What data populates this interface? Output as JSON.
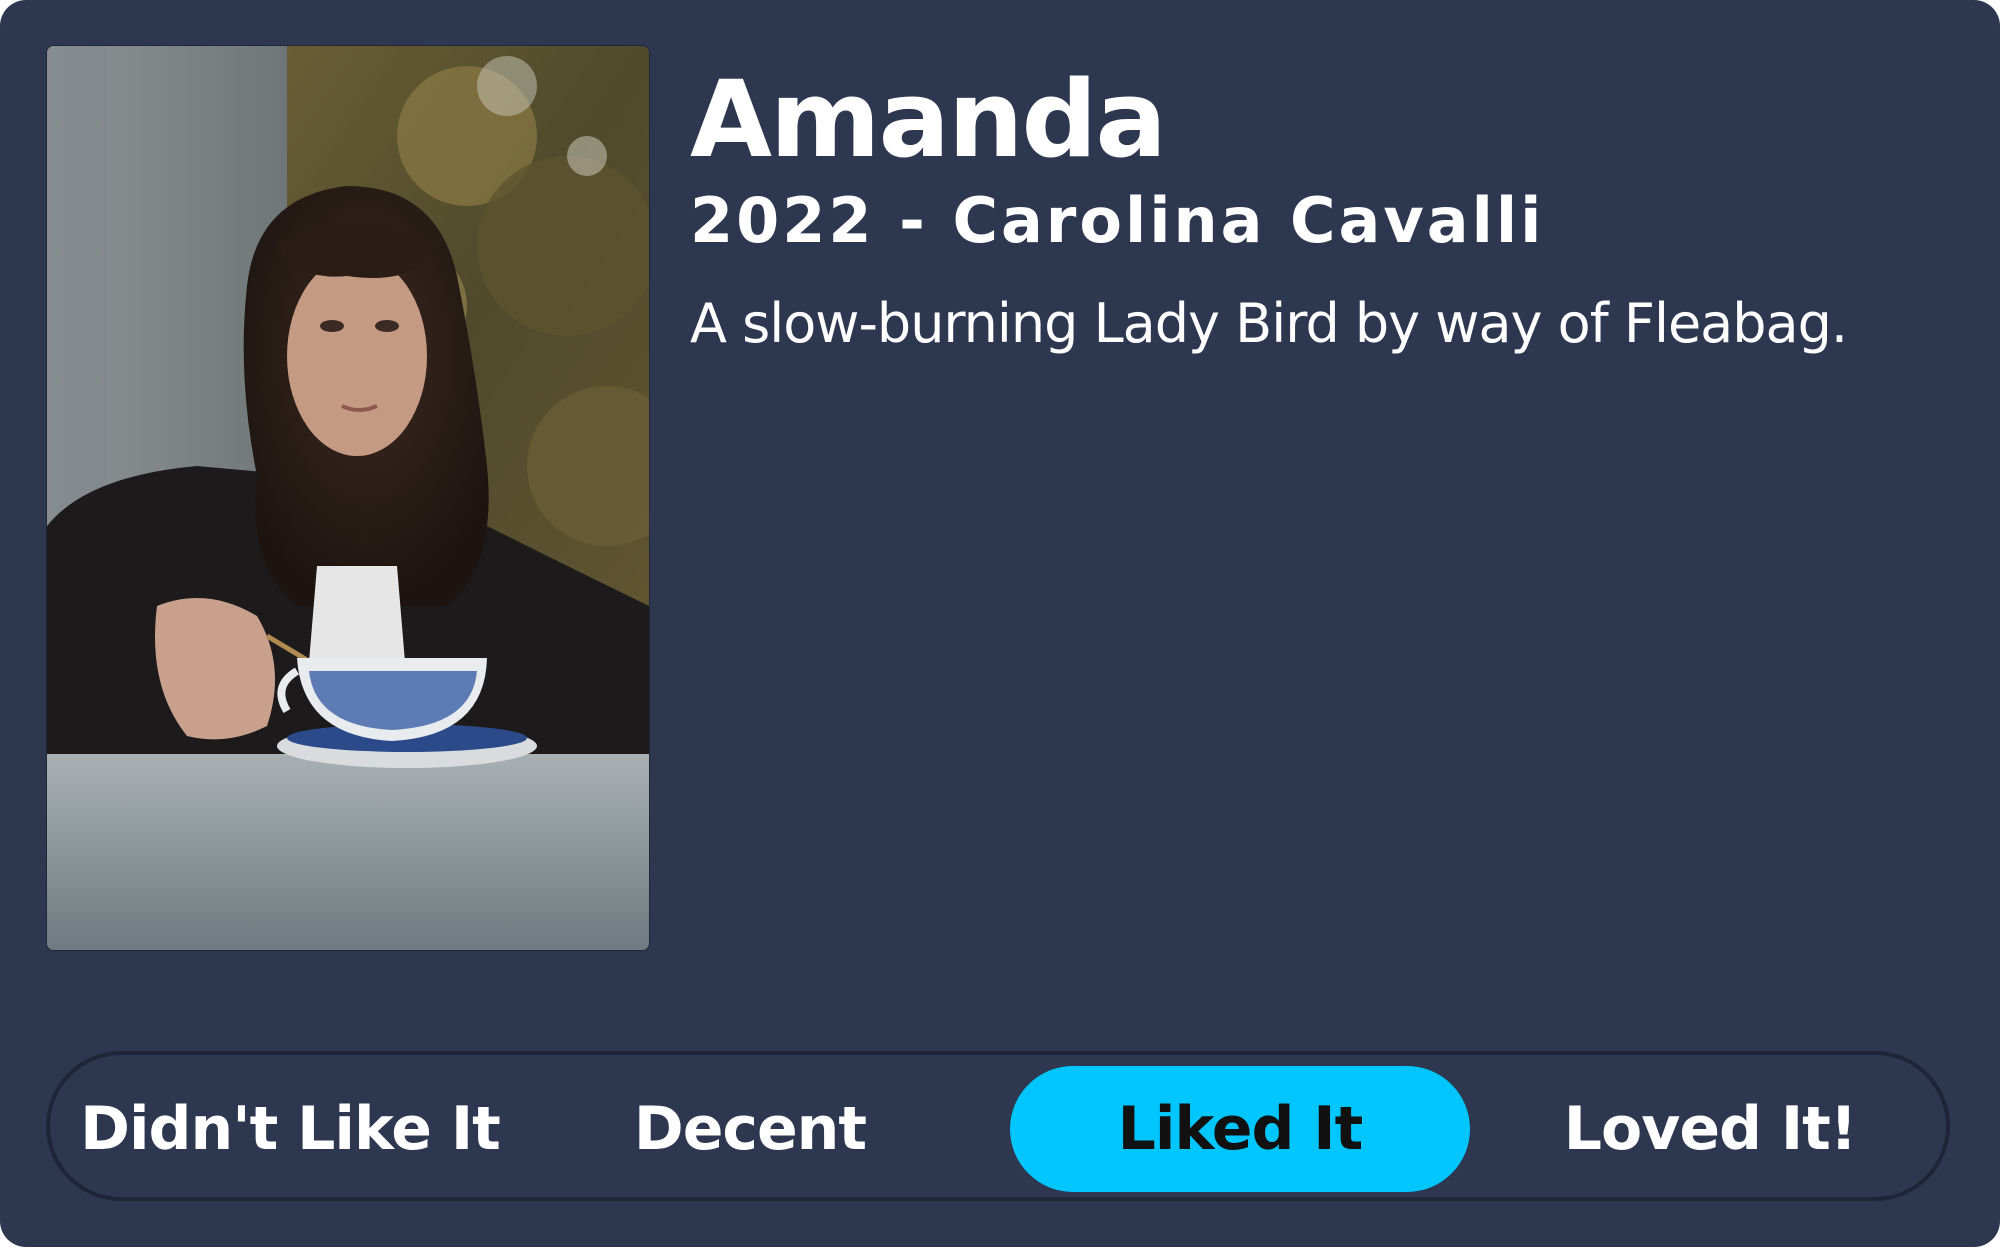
{
  "movie": {
    "title": "Amanda",
    "year_director": "2022 - Carolina Cavalli",
    "tagline": "A slow-burning Lady Bird by way of Fleabag."
  },
  "rating": {
    "options": [
      {
        "label": "Didn't Like It",
        "selected": false
      },
      {
        "label": "Decent",
        "selected": false
      },
      {
        "label": "Liked It",
        "selected": true
      },
      {
        "label": "Loved It!",
        "selected": false
      }
    ],
    "selected_index": 2,
    "accent_color": "#00c6ff"
  },
  "colors": {
    "card_background": "#2d3850",
    "bar_border": "#1d2536",
    "text": "#ffffff"
  }
}
